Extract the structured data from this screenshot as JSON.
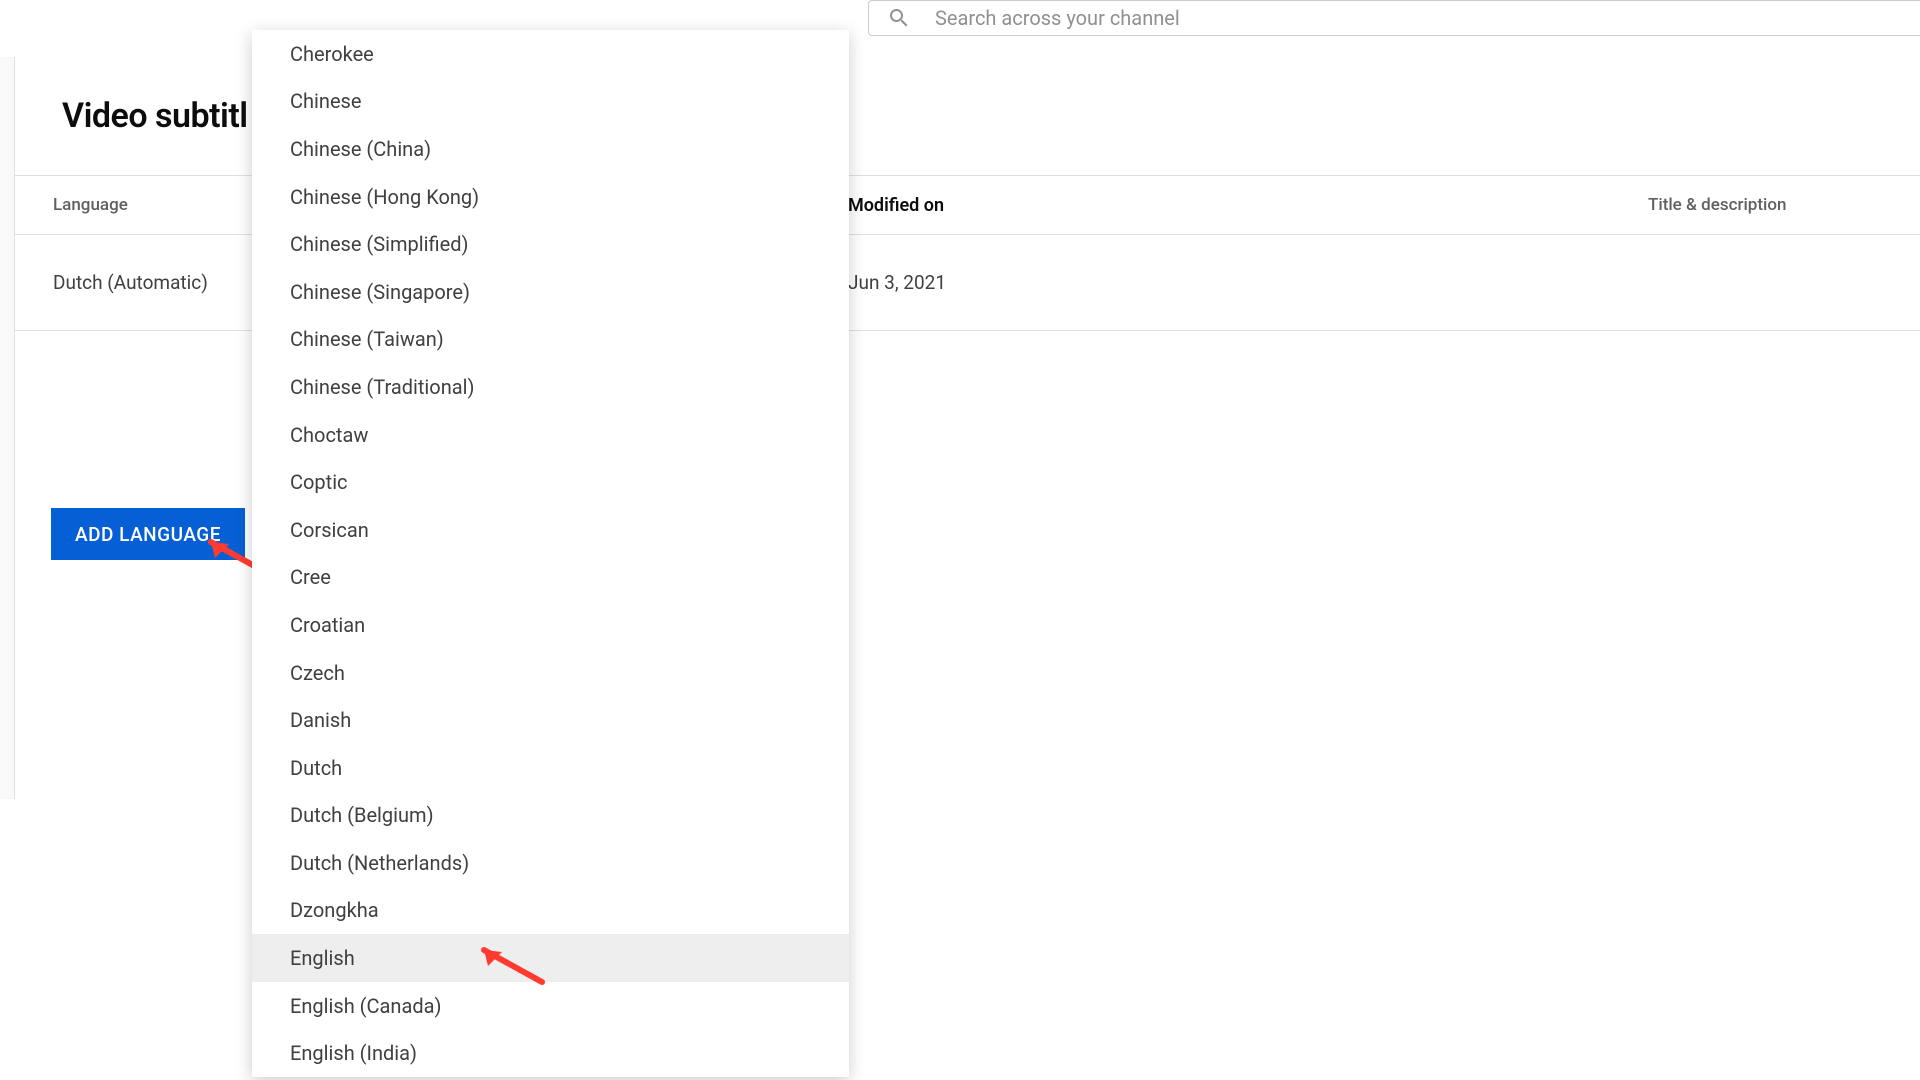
{
  "search": {
    "placeholder": "Search across your channel"
  },
  "page": {
    "title": "Video subtitl"
  },
  "table": {
    "headers": {
      "language": "Language",
      "modified": "Modified on",
      "title_desc": "Title & description"
    },
    "rows": [
      {
        "language": "Dutch (Automatic)",
        "modified": "Jun 3, 2021"
      }
    ]
  },
  "buttons": {
    "add_language": "ADD LANGUAGE"
  },
  "dropdown": {
    "items": [
      "Cherokee",
      "Chinese",
      "Chinese (China)",
      "Chinese (Hong Kong)",
      "Chinese (Simplified)",
      "Chinese (Singapore)",
      "Chinese (Taiwan)",
      "Chinese (Traditional)",
      "Choctaw",
      "Coptic",
      "Corsican",
      "Cree",
      "Croatian",
      "Czech",
      "Danish",
      "Dutch",
      "Dutch (Belgium)",
      "Dutch (Netherlands)",
      "Dzongkha",
      "English",
      "English (Canada)",
      "English (India)"
    ],
    "hovered_index": 19
  },
  "colors": {
    "primary": "#065fd4",
    "arrow": "#ff3b30"
  }
}
